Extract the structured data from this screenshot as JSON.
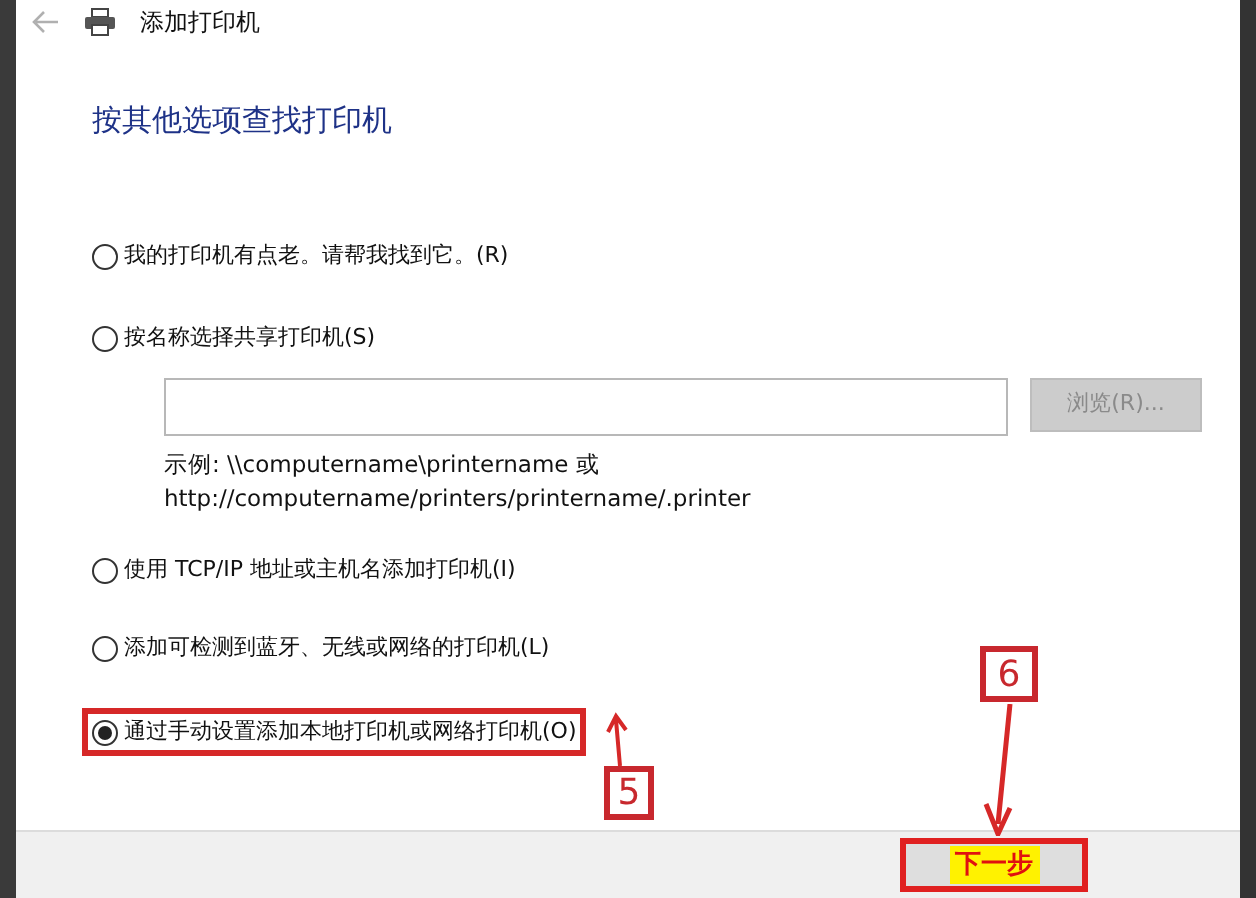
{
  "window": {
    "title": "添加打印机"
  },
  "heading": "按其他选项查找打印机",
  "options": [
    {
      "label": "我的打印机有点老。请帮我找到它。(R)",
      "selected": false,
      "highlighted": false
    },
    {
      "label": "按名称选择共享打印机(S)",
      "selected": false,
      "highlighted": false,
      "path_input": {
        "browse_button": "浏览(R)...",
        "browse_disabled": true,
        "example_lines": [
          "示例: \\\\computername\\printername 或",
          "http://computername/printers/printername/.printer"
        ]
      }
    },
    {
      "label": "使用 TCP/IP 地址或主机名添加打印机(I)",
      "selected": false,
      "highlighted": false
    },
    {
      "label": "添加可检测到蓝牙、无线或网络的打印机(L)",
      "selected": false,
      "highlighted": false
    },
    {
      "label": "通过手动设置添加本地打印机或网络打印机(O)",
      "selected": true,
      "highlighted": true
    }
  ],
  "next_button": {
    "label": "下一步",
    "highlighted": true
  },
  "callouts": [
    {
      "label": "5"
    },
    {
      "label": "6"
    }
  ]
}
